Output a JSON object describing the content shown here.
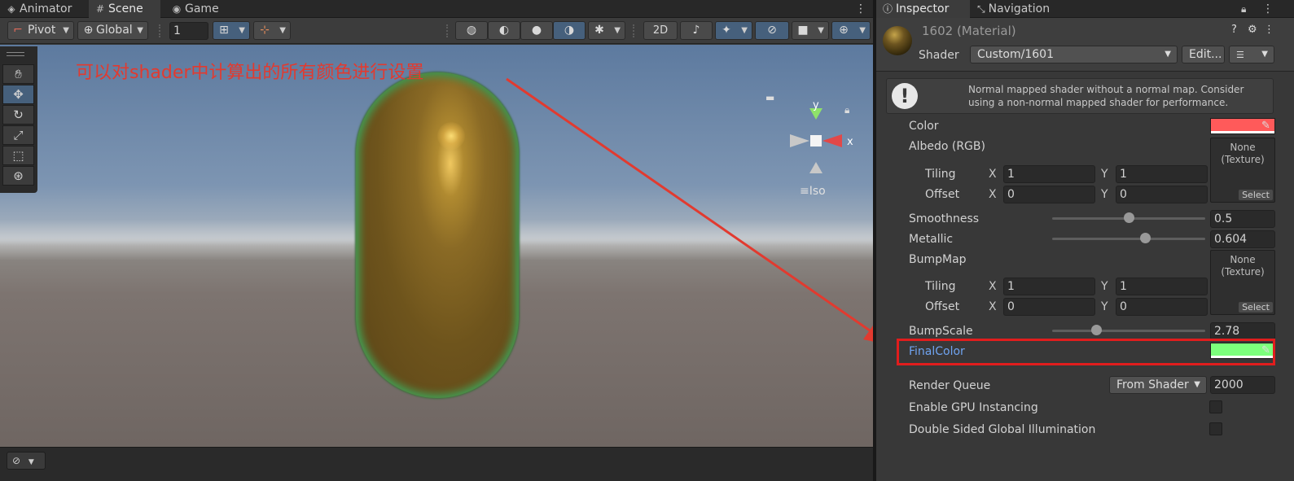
{
  "scene_tabs": {
    "animator": "Animator",
    "scene": "Scene",
    "game": "Game"
  },
  "toolbar": {
    "pivot": "Pivot",
    "global": "Global",
    "grid_value": "1",
    "mode_2d": "2D"
  },
  "viewport": {
    "annotation": "可以对shader中计算出的所有颜色进行设置",
    "gizmo_y": "y",
    "gizmo_x": "x",
    "projection": "Iso"
  },
  "inspector_tabs": {
    "inspector": "Inspector",
    "navigation": "Navigation"
  },
  "material": {
    "title": "1602 (Material)",
    "shader_label": "Shader",
    "shader_value": "Custom/1601",
    "edit_button": "Edit..."
  },
  "helpbox": {
    "message": "Normal mapped shader without a normal map. Consider using a non-normal mapped shader for performance."
  },
  "properties": {
    "color_label": "Color",
    "color_value": "#ff5a5a",
    "albedo_label": "Albedo (RGB)",
    "albedo_tiling_label": "Tiling",
    "albedo_offset_label": "Offset",
    "albedo_tiling_x": "1",
    "albedo_tiling_y": "1",
    "albedo_offset_x": "0",
    "albedo_offset_y": "0",
    "albedo_texture": "None\n(Texture)",
    "select": "Select",
    "smoothness_label": "Smoothness",
    "smoothness_value": "0.5",
    "smoothness_fraction": 0.5,
    "metallic_label": "Metallic",
    "metallic_value": "0.604",
    "metallic_fraction": 0.604,
    "bumpmap_label": "BumpMap",
    "bump_tiling_label": "Tiling",
    "bump_offset_label": "Offset",
    "bump_tiling_x": "1",
    "bump_tiling_y": "1",
    "bump_offset_x": "0",
    "bump_offset_y": "0",
    "bump_texture": "None\n(Texture)",
    "bumpscale_label": "BumpScale",
    "bumpscale_value": "2.78",
    "finalcolor_label": "FinalColor",
    "finalcolor_value": "#7cff7c",
    "axis_x": "X",
    "axis_y": "Y"
  },
  "footer": {
    "render_queue_label": "Render Queue",
    "render_queue_mode": "From Shader",
    "render_queue_value": "2000",
    "gpu_instancing_label": "Enable GPU Instancing",
    "gpu_instancing_checked": false,
    "double_sided_gi_label": "Double Sided Global Illumination",
    "double_sided_gi_checked": false
  },
  "colors": {
    "annotation_red": "#e23a2f",
    "highlight_red": "#e11d1d",
    "selected_blue": "#46607c",
    "label_highlight": "#6fa3f0"
  }
}
